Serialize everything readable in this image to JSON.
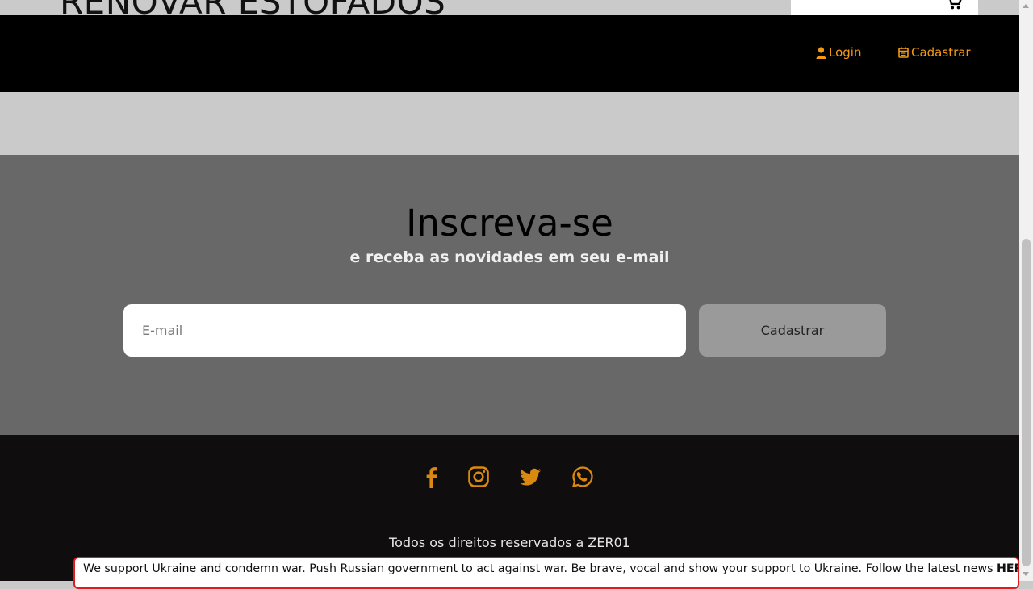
{
  "top": {
    "heading": "RENOVAR ESTOFADOS",
    "cart_icon": "shopping-cart-icon"
  },
  "header": {
    "login_label": "Login",
    "login_icon": "user-icon",
    "register_label": "Cadastrar",
    "register_icon": "calendar-icon",
    "accent_color": "#f39a13"
  },
  "newsletter": {
    "title": "Inscreva-se",
    "subtitle": "e receba as novidades em seu e-mail",
    "email_placeholder": "E-mail",
    "email_value": "",
    "submit_label": "Cadastrar"
  },
  "footer": {
    "social_icons": [
      "facebook-icon",
      "instagram-icon",
      "twitter-icon",
      "whatsapp-icon"
    ],
    "copyright": "Todos os direitos reservados a ZER01",
    "icon_color": "#d9890f"
  },
  "banner": {
    "text": "We support Ukraine and condemn war. Push Russian government to act against war. Be brave, vocal and show your support to Ukraine. Follow the latest news",
    "link_label": "HERE",
    "border_color": "#e01b1b"
  }
}
